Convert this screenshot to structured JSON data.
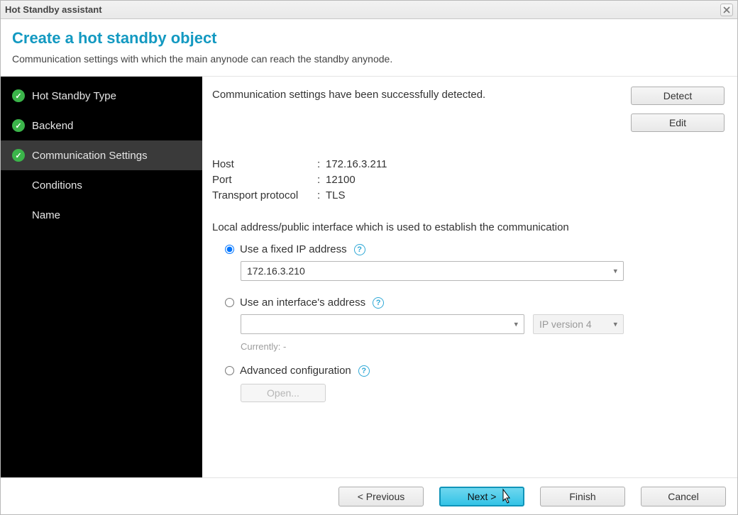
{
  "window": {
    "title": "Hot Standby assistant"
  },
  "header": {
    "title": "Create a hot standby object",
    "subtitle": "Communication settings with which the main anynode can reach the standby anynode."
  },
  "sidebar": {
    "items": [
      {
        "label": "Hot Standby Type",
        "done": true,
        "active": false
      },
      {
        "label": "Backend",
        "done": true,
        "active": false
      },
      {
        "label": "Communication Settings",
        "done": true,
        "active": true
      },
      {
        "label": "Conditions",
        "done": false,
        "active": false
      },
      {
        "label": "Name",
        "done": false,
        "active": false
      }
    ]
  },
  "main": {
    "status": "Communication settings have been successfully detected.",
    "detect_label": "Detect",
    "edit_label": "Edit",
    "kv": {
      "host_label": "Host",
      "host_value": "172.16.3.211",
      "port_label": "Port",
      "port_value": "12100",
      "proto_label": "Transport protocol",
      "proto_value": "TLS"
    },
    "section_label": "Local address/public interface which is used to establish the communication",
    "opt_fixed": {
      "label": "Use a fixed IP address",
      "value": "172.16.3.210"
    },
    "opt_iface": {
      "label": "Use an interface's address",
      "iface_value": "",
      "ipver_value": "IP version 4",
      "currently_label": "Currently: -"
    },
    "opt_adv": {
      "label": "Advanced configuration",
      "open_label": "Open..."
    }
  },
  "footer": {
    "previous": "< Previous",
    "next": "Next >",
    "finish": "Finish",
    "cancel": "Cancel"
  }
}
